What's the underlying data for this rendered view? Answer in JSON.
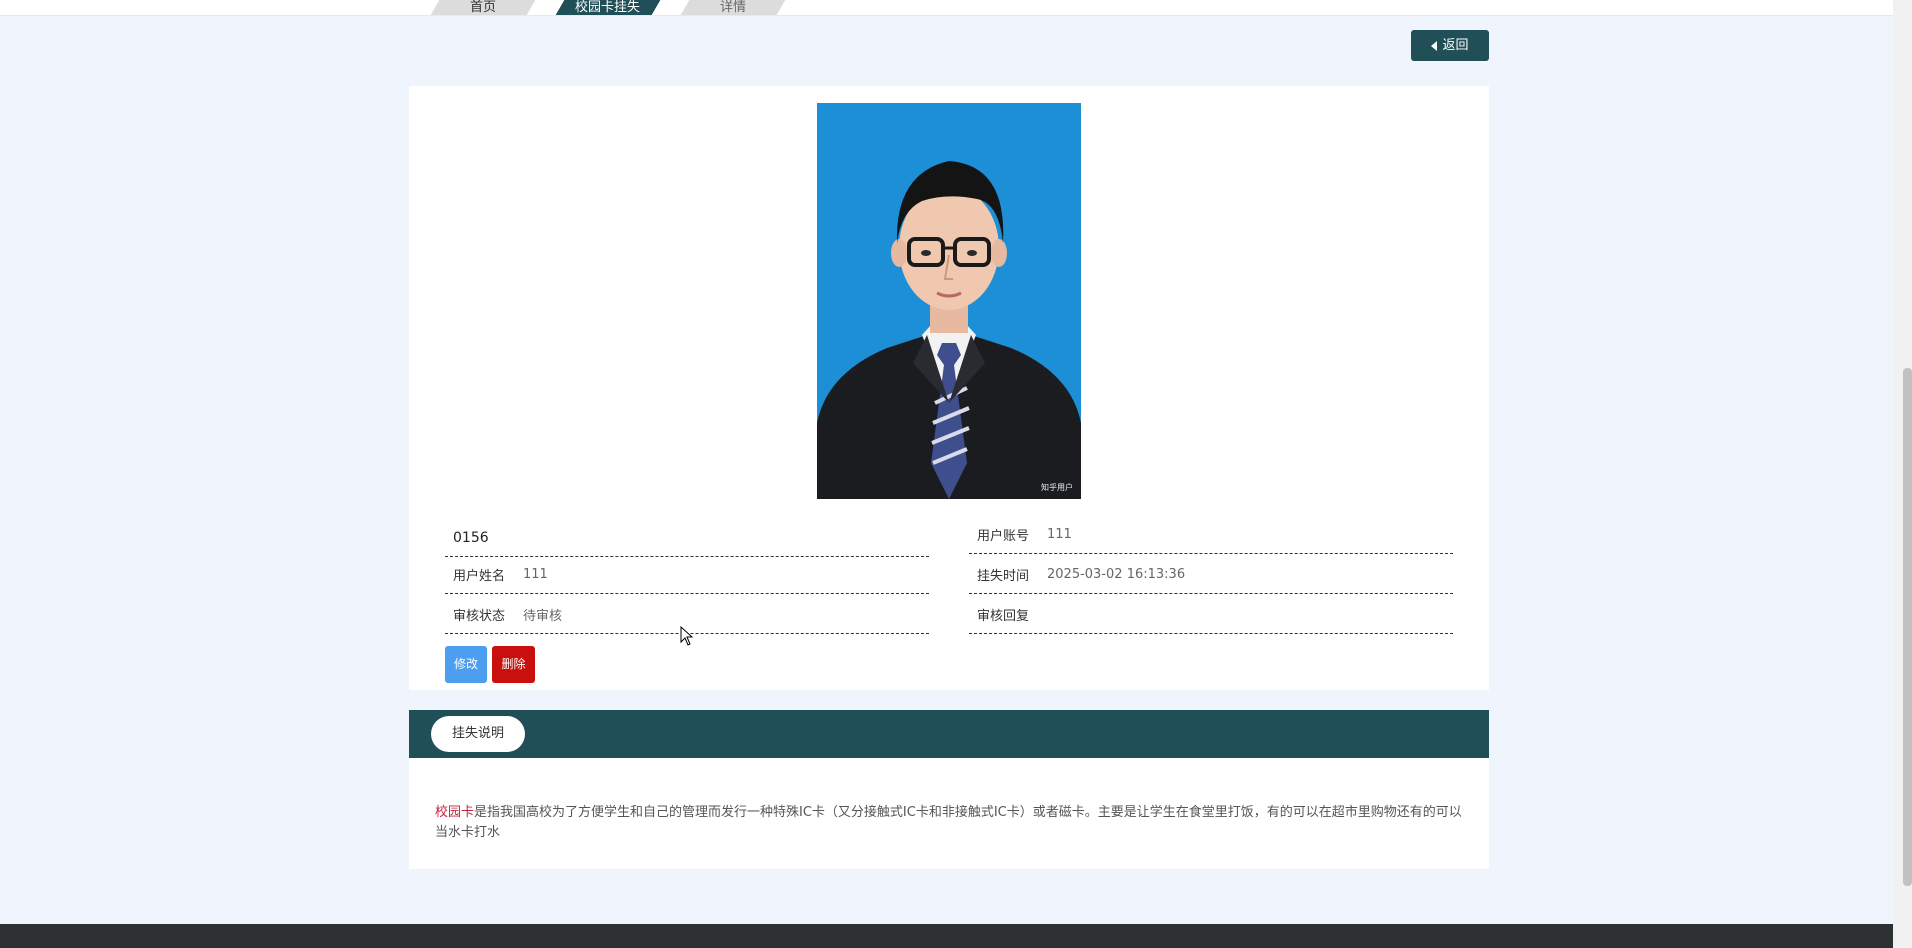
{
  "breadcrumb": {
    "items": [
      "首页",
      "校园卡挂失",
      "详情"
    ]
  },
  "back_button": {
    "label": "返回"
  },
  "photo": {
    "watermark": "知乎用户"
  },
  "detail": {
    "card_number": "0156",
    "account_label": "用户账号",
    "account_value": "111",
    "name_label": "用户姓名",
    "name_value": "111",
    "time_label": "挂失时间",
    "time_value": "2025-03-02 16:13:36",
    "status_label": "审核状态",
    "status_value": "待审核",
    "reply_label": "审核回复",
    "reply_value": ""
  },
  "actions": {
    "edit_label": "修改",
    "delete_label": "删除"
  },
  "section": {
    "tab_label": "挂失说明",
    "highlight": "校园卡",
    "text": "是指我国高校为了方便学生和自己的管理而发行一种特殊IC卡（又分接触式IC卡和非接触式IC卡）或者磁卡。主要是让学生在食堂里打饭，有的可以在超市里购物还有的可以当水卡打水"
  },
  "colors": {
    "primary": "#204f57",
    "edit": "#4b9ef0",
    "delete": "#c9100f",
    "highlight": "#c2263f",
    "page_bg": "#f0f5fd"
  }
}
